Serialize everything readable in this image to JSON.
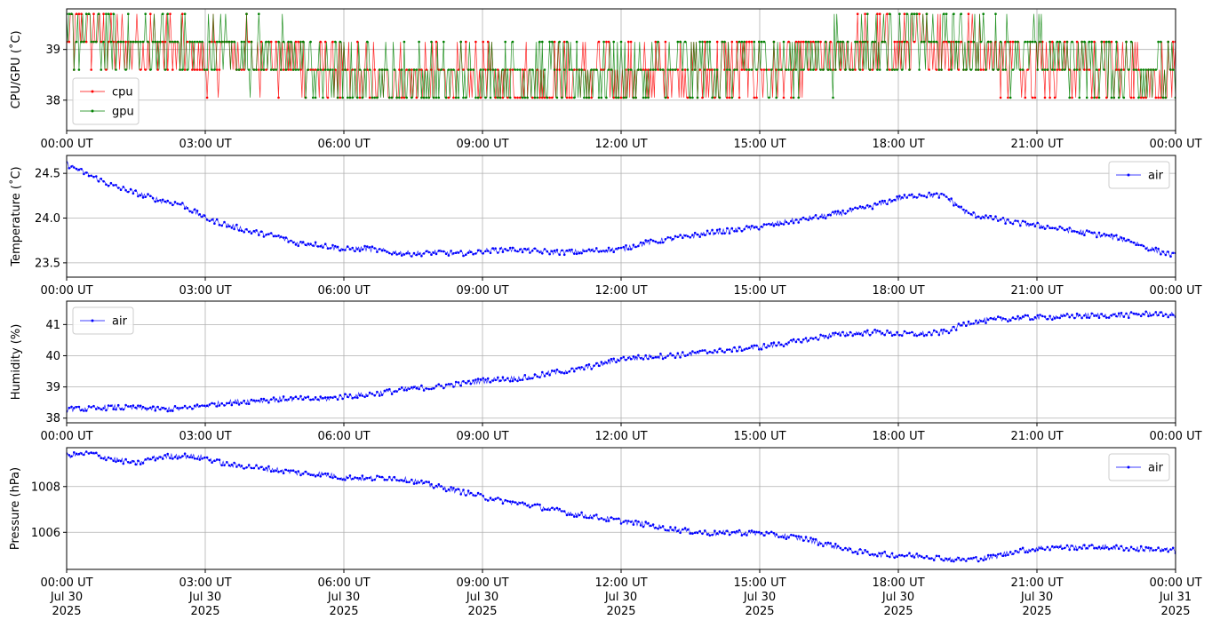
{
  "chart_data": [
    {
      "type": "line",
      "ylabel": "CPU/GPU (˚C)",
      "xlim": [
        0,
        24
      ],
      "ylim": [
        37.4,
        39.8
      ],
      "grid": true,
      "legend_position": "lower-left",
      "x_ticks": [
        0,
        3,
        6,
        9,
        12,
        15,
        18,
        21,
        24
      ],
      "x_tick_labels": [
        "00:00 UT",
        "03:00 UT",
        "06:00 UT",
        "09:00 UT",
        "12:00 UT",
        "15:00 UT",
        "18:00 UT",
        "21:00 UT",
        "00:00 UT"
      ],
      "y_ticks": [
        38,
        39
      ],
      "y_tick_labels": [
        "38",
        "39"
      ],
      "series": [
        {
          "name": "cpu",
          "color": "#ff0000",
          "x": [
            0.0,
            0.5,
            1.0,
            1.5,
            2.0,
            2.5,
            3.0,
            3.5,
            4.0,
            4.5,
            5.0,
            5.5,
            6.0,
            6.5,
            7.0,
            7.5,
            8.0,
            8.5,
            9.0,
            9.5,
            10.0,
            10.5,
            11.0,
            11.5,
            12.0,
            12.5,
            13.0,
            13.5,
            14.0,
            14.5,
            15.0,
            15.5,
            16.0,
            16.5,
            17.0,
            17.5,
            18.0,
            18.5,
            19.0,
            19.5,
            20.0,
            20.5,
            21.0,
            21.5,
            22.0,
            22.5,
            23.0,
            23.5,
            24.0
          ],
          "values": [
            39.1,
            39.2,
            38.9,
            39.0,
            39.0,
            38.8,
            38.8,
            38.8,
            38.8,
            38.7,
            38.6,
            38.4,
            38.4,
            38.3,
            38.3,
            38.3,
            38.3,
            38.3,
            38.4,
            38.3,
            38.3,
            38.3,
            38.3,
            38.4,
            38.3,
            38.4,
            38.4,
            38.4,
            38.4,
            38.5,
            38.5,
            38.5,
            38.6,
            38.7,
            38.8,
            38.9,
            38.9,
            39.0,
            39.0,
            38.9,
            38.8,
            38.7,
            38.7,
            38.6,
            38.6,
            38.5,
            38.5,
            38.4,
            38.3
          ]
        },
        {
          "name": "gpu",
          "color": "#008000",
          "x": [
            0.0,
            0.5,
            1.0,
            1.5,
            2.0,
            2.5,
            3.0,
            3.5,
            4.0,
            4.5,
            5.0,
            5.5,
            6.0,
            6.5,
            7.0,
            7.5,
            8.0,
            8.5,
            9.0,
            9.5,
            10.0,
            10.5,
            11.0,
            11.5,
            12.0,
            12.5,
            13.0,
            13.5,
            14.0,
            14.5,
            15.0,
            15.5,
            16.0,
            16.5,
            17.0,
            17.5,
            18.0,
            18.5,
            19.0,
            19.5,
            20.0,
            20.5,
            21.0,
            21.5,
            22.0,
            22.5,
            23.0,
            23.5,
            24.0
          ],
          "values": [
            39.2,
            39.2,
            39.0,
            39.0,
            39.0,
            38.9,
            38.9,
            38.9,
            38.8,
            38.8,
            38.7,
            38.4,
            38.4,
            38.3,
            38.3,
            38.3,
            38.3,
            38.3,
            38.4,
            38.4,
            38.4,
            38.4,
            38.4,
            38.4,
            38.4,
            38.4,
            38.5,
            38.5,
            38.5,
            38.5,
            38.6,
            38.6,
            38.7,
            38.8,
            38.9,
            39.0,
            39.0,
            39.1,
            39.0,
            39.0,
            38.9,
            38.8,
            38.8,
            38.7,
            38.7,
            38.6,
            38.6,
            38.5,
            38.4
          ]
        }
      ]
    },
    {
      "type": "line",
      "ylabel": "Temperature (˚C)",
      "xlim": [
        0,
        24
      ],
      "ylim": [
        23.34,
        24.7
      ],
      "grid": true,
      "legend_position": "upper-right",
      "x_ticks": [
        0,
        3,
        6,
        9,
        12,
        15,
        18,
        21,
        24
      ],
      "x_tick_labels": [
        "00:00 UT",
        "03:00 UT",
        "06:00 UT",
        "09:00 UT",
        "12:00 UT",
        "15:00 UT",
        "18:00 UT",
        "21:00 UT",
        "00:00 UT"
      ],
      "y_ticks": [
        23.5,
        24.0,
        24.5
      ],
      "y_tick_labels": [
        "23.5",
        "24.0",
        "24.5"
      ],
      "series": [
        {
          "name": "air",
          "color": "#0000ff",
          "x": [
            0.0,
            0.5,
            1.0,
            1.5,
            2.0,
            2.5,
            3.0,
            3.5,
            4.0,
            4.5,
            5.0,
            5.5,
            6.0,
            6.5,
            7.0,
            7.5,
            8.0,
            8.5,
            9.0,
            9.5,
            10.0,
            10.5,
            11.0,
            11.5,
            12.0,
            12.5,
            13.0,
            13.5,
            14.0,
            14.5,
            15.0,
            15.5,
            16.0,
            16.5,
            17.0,
            17.5,
            18.0,
            18.5,
            19.0,
            19.5,
            20.0,
            20.5,
            21.0,
            21.5,
            22.0,
            22.5,
            23.0,
            23.5,
            24.0
          ],
          "values": [
            24.6,
            24.48,
            24.36,
            24.28,
            24.2,
            24.15,
            24.0,
            23.92,
            23.85,
            23.8,
            23.72,
            23.7,
            23.65,
            23.66,
            23.62,
            23.6,
            23.62,
            23.6,
            23.63,
            23.65,
            23.64,
            23.62,
            23.62,
            23.64,
            23.65,
            23.72,
            23.76,
            23.8,
            23.84,
            23.87,
            23.9,
            23.95,
            23.99,
            24.03,
            24.08,
            24.14,
            24.22,
            24.26,
            24.25,
            24.05,
            24.0,
            23.95,
            23.92,
            23.88,
            23.84,
            23.8,
            23.75,
            23.65,
            23.58
          ]
        }
      ]
    },
    {
      "type": "line",
      "ylabel": "Humidity (%)",
      "xlim": [
        0,
        24
      ],
      "ylim": [
        37.85,
        41.75
      ],
      "grid": true,
      "legend_position": "upper-left",
      "x_ticks": [
        0,
        3,
        6,
        9,
        12,
        15,
        18,
        21,
        24
      ],
      "x_tick_labels": [
        "00:00 UT",
        "03:00 UT",
        "06:00 UT",
        "09:00 UT",
        "12:00 UT",
        "15:00 UT",
        "18:00 UT",
        "21:00 UT",
        "00:00 UT"
      ],
      "y_ticks": [
        38,
        39,
        40,
        41
      ],
      "y_tick_labels": [
        "38",
        "39",
        "40",
        "41"
      ],
      "series": [
        {
          "name": "air",
          "color": "#0000ff",
          "x": [
            0.0,
            0.5,
            1.0,
            1.5,
            2.0,
            2.5,
            3.0,
            3.5,
            4.0,
            4.5,
            5.0,
            5.5,
            6.0,
            6.5,
            7.0,
            7.5,
            8.0,
            8.5,
            9.0,
            9.5,
            10.0,
            10.5,
            11.0,
            11.5,
            12.0,
            12.5,
            13.0,
            13.5,
            14.0,
            14.5,
            15.0,
            15.5,
            16.0,
            16.5,
            17.0,
            17.5,
            18.0,
            18.5,
            19.0,
            19.5,
            20.0,
            20.5,
            21.0,
            21.5,
            22.0,
            22.5,
            23.0,
            23.5,
            24.0
          ],
          "values": [
            38.3,
            38.3,
            38.35,
            38.32,
            38.3,
            38.3,
            38.4,
            38.5,
            38.55,
            38.6,
            38.62,
            38.6,
            38.7,
            38.75,
            38.85,
            38.95,
            39.0,
            39.1,
            39.2,
            39.25,
            39.3,
            39.45,
            39.55,
            39.7,
            39.9,
            39.95,
            40.0,
            40.05,
            40.15,
            40.2,
            40.28,
            40.38,
            40.5,
            40.65,
            40.72,
            40.75,
            40.7,
            40.7,
            40.75,
            41.05,
            41.15,
            41.2,
            41.22,
            41.25,
            41.28,
            41.3,
            41.3,
            41.35,
            41.3
          ]
        }
      ]
    },
    {
      "type": "line",
      "ylabel": "Pressure (hPa)",
      "xlim": [
        0,
        24
      ],
      "ylim": [
        1004.38,
        1009.7
      ],
      "grid": true,
      "legend_position": "upper-right",
      "x_ticks": [
        0,
        3,
        6,
        9,
        12,
        15,
        18,
        21,
        24
      ],
      "x_tick_labels": [
        "00:00 UT\nJul 30\n2025",
        "03:00 UT\nJul 30\n2025",
        "06:00 UT\nJul 30\n2025",
        "09:00 UT\nJul 30\n2025",
        "12:00 UT\nJul 30\n2025",
        "15:00 UT\nJul 30\n2025",
        "18:00 UT\nJul 30\n2025",
        "21:00 UT\nJul 30\n2025",
        "00:00 UT\nJul 31\n2025"
      ],
      "y_ticks": [
        1006,
        1008
      ],
      "y_tick_labels": [
        "1006",
        "1008"
      ],
      "series": [
        {
          "name": "air",
          "color": "#0000ff",
          "x": [
            0.0,
            0.5,
            1.0,
            1.5,
            2.0,
            2.5,
            3.0,
            3.5,
            4.0,
            4.5,
            5.0,
            5.5,
            6.0,
            6.5,
            7.0,
            7.5,
            8.0,
            8.5,
            9.0,
            9.5,
            10.0,
            10.5,
            11.0,
            11.5,
            12.0,
            12.5,
            13.0,
            13.5,
            14.0,
            14.5,
            15.0,
            15.5,
            16.0,
            16.5,
            17.0,
            17.5,
            18.0,
            18.5,
            19.0,
            19.5,
            20.0,
            20.5,
            21.0,
            21.5,
            22.0,
            22.5,
            23.0,
            23.5,
            24.0
          ],
          "values": [
            1009.35,
            1009.45,
            1009.2,
            1009.0,
            1009.3,
            1009.35,
            1009.25,
            1008.95,
            1008.85,
            1008.75,
            1008.6,
            1008.55,
            1008.4,
            1008.35,
            1008.4,
            1008.25,
            1008.0,
            1007.8,
            1007.55,
            1007.35,
            1007.2,
            1007.0,
            1006.8,
            1006.65,
            1006.5,
            1006.35,
            1006.15,
            1006.05,
            1005.95,
            1006.0,
            1005.95,
            1005.85,
            1005.7,
            1005.45,
            1005.2,
            1005.05,
            1005.0,
            1004.97,
            1004.85,
            1004.8,
            1004.9,
            1005.15,
            1005.3,
            1005.35,
            1005.35,
            1005.35,
            1005.3,
            1005.25,
            1005.2
          ]
        }
      ]
    }
  ]
}
